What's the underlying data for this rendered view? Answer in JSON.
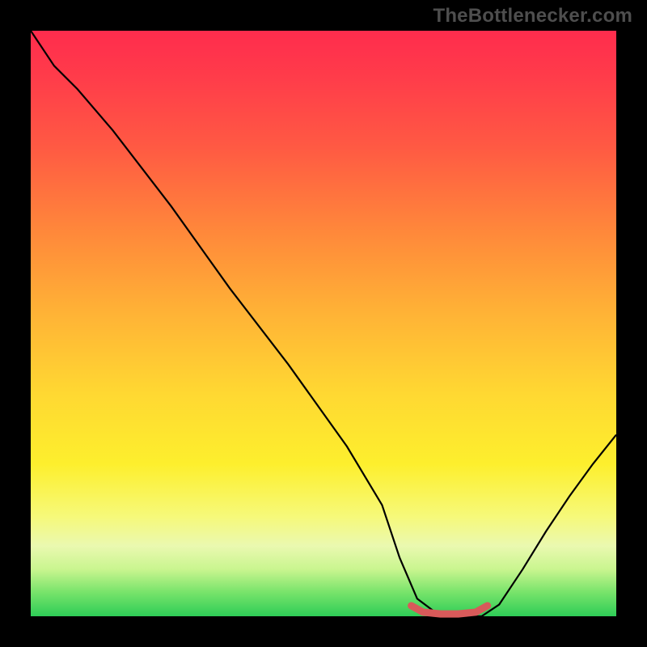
{
  "watermark": {
    "text": "TheBottlenecker.com"
  },
  "chart_data": {
    "type": "line",
    "title": "",
    "xlabel": "",
    "ylabel": "",
    "xlim": [
      0,
      100
    ],
    "ylim": [
      0,
      100
    ],
    "series": [
      {
        "name": "bottleneck-curve",
        "color": "#000000",
        "stroke_width": 2.2,
        "x": [
          0,
          4,
          8,
          14,
          24,
          34,
          44,
          54,
          60,
          63,
          66,
          70,
          74,
          77,
          80,
          84,
          88,
          92,
          96,
          100
        ],
        "y": [
          100,
          94,
          90,
          83,
          70,
          56,
          43,
          29,
          19,
          10,
          3,
          0,
          0,
          0,
          2,
          8,
          14.5,
          20.5,
          26,
          31
        ]
      },
      {
        "name": "optimal-band",
        "color": "#d85a5a",
        "stroke_width": 9,
        "linecap": "round",
        "x": [
          65,
          67,
          70,
          73,
          76,
          78
        ],
        "y": [
          1.8,
          0.7,
          0.4,
          0.4,
          0.7,
          1.8
        ]
      }
    ],
    "gradient_stops": [
      {
        "pos": 0,
        "color": "#ff2c4d"
      },
      {
        "pos": 8,
        "color": "#ff3c4a"
      },
      {
        "pos": 20,
        "color": "#ff5a43"
      },
      {
        "pos": 35,
        "color": "#ff8a3a"
      },
      {
        "pos": 48,
        "color": "#ffb236"
      },
      {
        "pos": 62,
        "color": "#ffd832"
      },
      {
        "pos": 74,
        "color": "#fdef2d"
      },
      {
        "pos": 83,
        "color": "#f6f97a"
      },
      {
        "pos": 88,
        "color": "#eaf9b0"
      },
      {
        "pos": 92,
        "color": "#c9f58f"
      },
      {
        "pos": 96,
        "color": "#76e36a"
      },
      {
        "pos": 100,
        "color": "#2ecd57"
      }
    ]
  }
}
